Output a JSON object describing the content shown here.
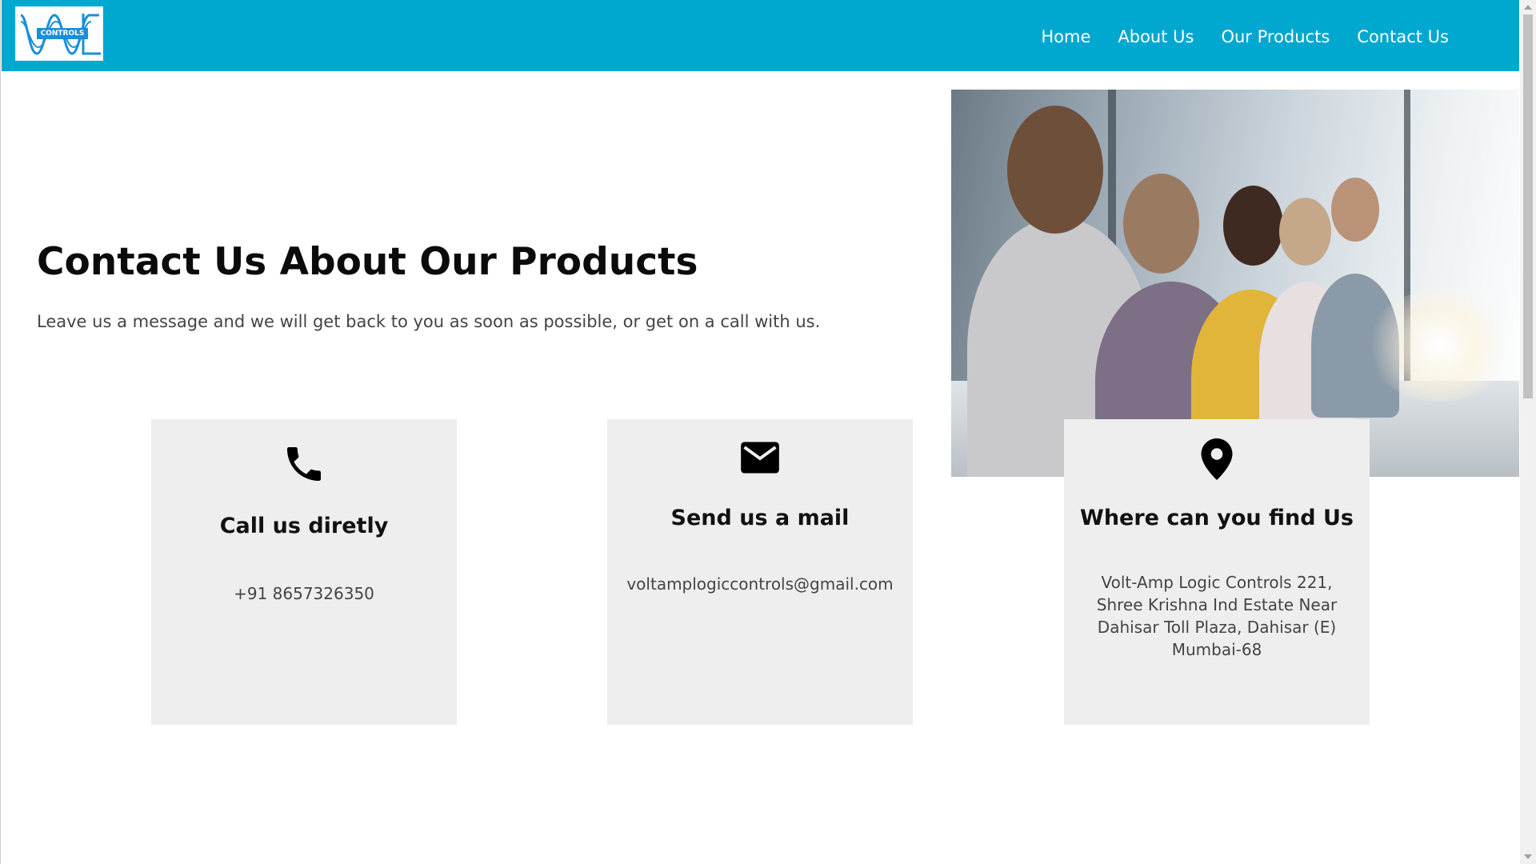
{
  "header": {
    "logo_text": "CONTROLS",
    "brand_color": "#00a8cf",
    "nav": [
      {
        "label": "Home"
      },
      {
        "label": "About Us"
      },
      {
        "label": "Our Products"
      },
      {
        "label": "Contact Us"
      }
    ]
  },
  "hero": {
    "title": "Contact Us About Our Products",
    "subtitle": "Leave us a message and we will get back to you as soon as possible, or get on a call with us."
  },
  "photo": {
    "description_icon": "call-center-photo"
  },
  "cards": [
    {
      "icon": "phone-icon",
      "title": "Call us diretly",
      "text": "+91 8657326350"
    },
    {
      "icon": "mail-icon",
      "title": "Send us a mail",
      "text": "voltamplogiccontrols@gmail.com"
    },
    {
      "icon": "location-pin-icon",
      "title": "Where can you find Us",
      "text": "Volt-Amp Logic Controls 221, Shree Krishna Ind Estate Near Dahisar Toll Plaza, Dahisar (E) Mumbai-68"
    }
  ]
}
